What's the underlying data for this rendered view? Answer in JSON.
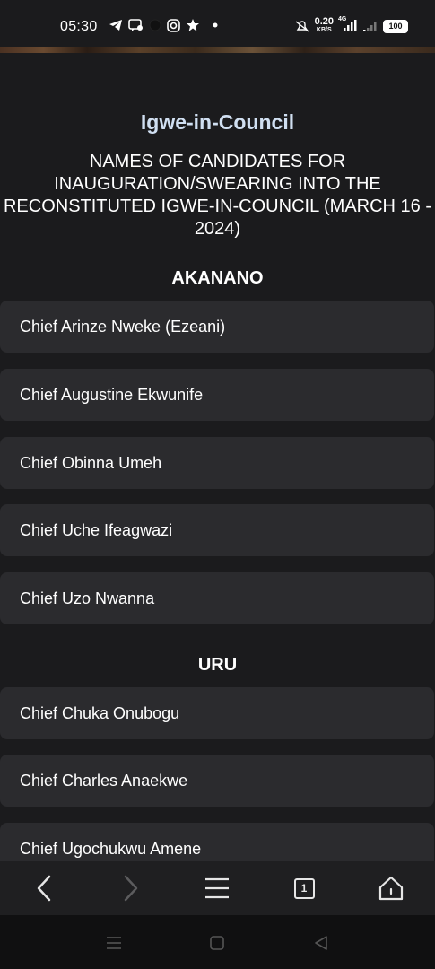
{
  "status_bar": {
    "time": "05:30",
    "network_speed": "0.20",
    "network_speed_unit": "KB/S",
    "network_type": "4G",
    "battery": "100",
    "left_icons": [
      "telegram-icon",
      "message-icon",
      "chat-icon",
      "instagram-icon",
      "star-icon",
      "dot-icon"
    ],
    "right_icons": [
      "alarm-off-icon",
      "signal-icon",
      "signal-weak-icon",
      "battery-icon"
    ]
  },
  "page": {
    "site_title": "Igwe-in-Council",
    "subtitle": "NAMES OF CANDIDATES FOR INAUGURATION/SWEARING INTO THE RECONSTITUTED IGWE-IN-COUNCIL (MARCH 16 - 2024)"
  },
  "sections": [
    {
      "title": "AKANANO",
      "candidates": [
        "Chief Arinze Nweke (Ezeani)",
        "Chief Augustine Ekwunife",
        "Chief Obinna Umeh",
        "Chief Uche Ifeagwazi",
        "Chief Uzo Nwanna"
      ]
    },
    {
      "title": "URU",
      "candidates": [
        "Chief Chuka Onubogu",
        "Chief Charles Anaekwe",
        "Chief Ugochukwu Amene"
      ]
    }
  ],
  "browser_nav": {
    "tab_count": "1",
    "icons": [
      "back-icon",
      "forward-icon",
      "menu-icon",
      "tabs-icon",
      "home-icon"
    ]
  },
  "system_nav": {
    "icons": [
      "recents-icon",
      "home-square-icon",
      "back-triangle-icon"
    ]
  },
  "colors": {
    "background": "#1b1b1d",
    "card": "#2b2b2e",
    "site_title": "#d0dff1",
    "nav_bar": "#1f1f21",
    "system_nav": "#101011"
  }
}
